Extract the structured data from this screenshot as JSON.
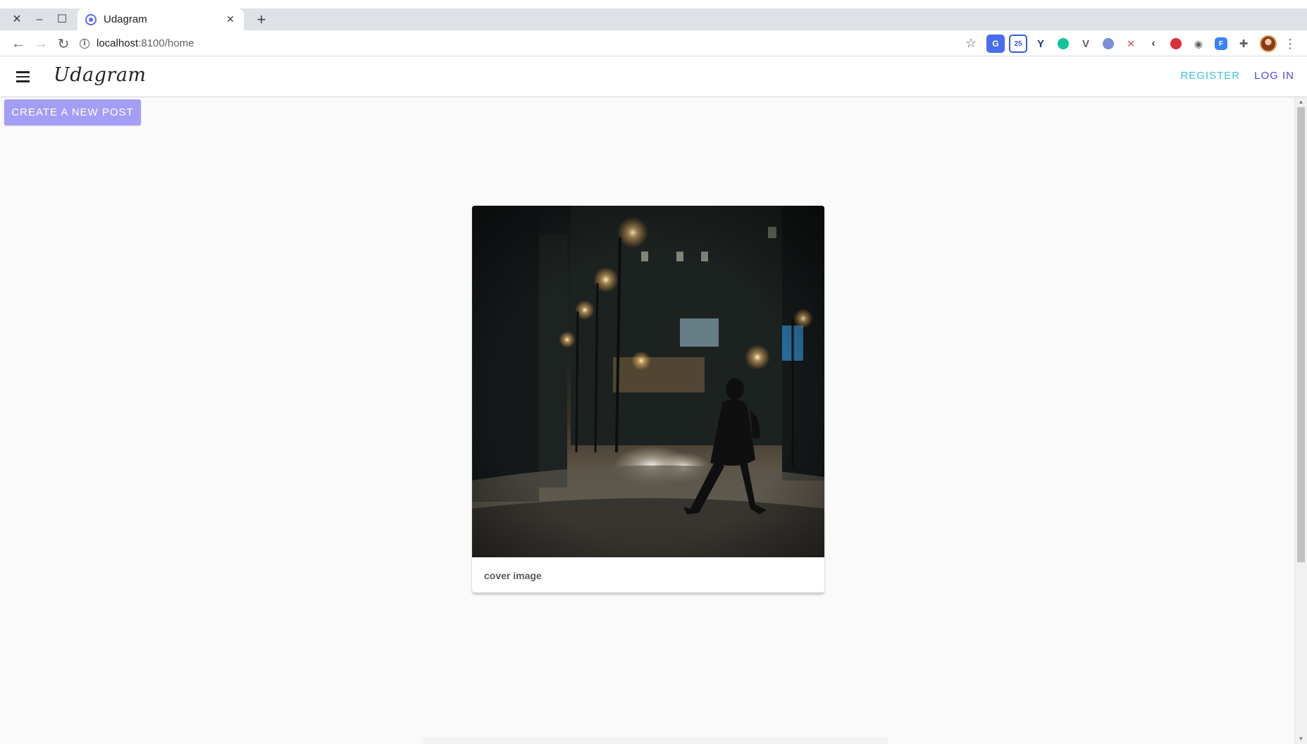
{
  "browser": {
    "tab": {
      "title": "Udagram",
      "favicon": "udagram-favicon"
    },
    "new_tab_symbol": "+",
    "window_controls": {
      "close": "✕",
      "minimize": "–",
      "maximize": "☐"
    },
    "address": {
      "host": "localhost",
      "path": ":8100/home"
    },
    "extensions": [
      "translate",
      "calendar-25",
      "vue",
      "grammarly",
      "vuetify",
      "ext-round",
      "ext-red",
      "ext-arrow",
      "lastpass",
      "camera",
      "ext-box",
      "puzzle"
    ]
  },
  "app": {
    "brand": "Udagram",
    "header": {
      "register_label": "REGISTER",
      "login_label": "LOG IN"
    },
    "create_post_label": "CREATE A NEW POST",
    "posts": [
      {
        "caption": "cover image"
      }
    ]
  },
  "colors": {
    "accent_register": "#3dc2d8",
    "accent_login": "#5045e0",
    "create_button": "#a39ef5"
  }
}
